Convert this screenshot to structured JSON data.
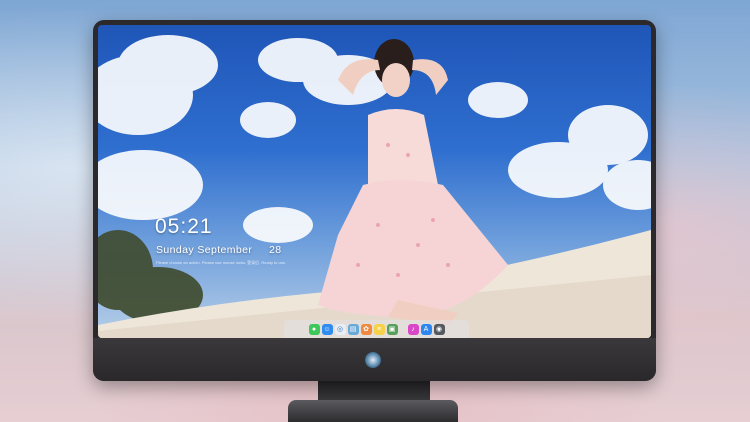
{
  "lockscreen": {
    "time": "05:21",
    "weekday": "Sunday",
    "month": "September",
    "day": "28",
    "notice": "Please choose an action. Please use mouse locks. 登录后. Ready to use."
  },
  "dock": {
    "items": [
      {
        "name": "messages-icon",
        "color": "#3fc85a",
        "glyph": "●"
      },
      {
        "name": "finder-icon",
        "color": "#2f8cf0",
        "glyph": "☺"
      },
      {
        "name": "safari-icon",
        "color": "#e8eef4",
        "glyph": "◎"
      },
      {
        "name": "preview-icon",
        "color": "#6aa8d8",
        "glyph": "▤"
      },
      {
        "name": "photos-icon",
        "color": "#f08a40",
        "glyph": "✿"
      },
      {
        "name": "notes-icon",
        "color": "#f5d24a",
        "glyph": "≡"
      },
      {
        "name": "image-capture-icon",
        "color": "#58a05a",
        "glyph": "▣"
      },
      {
        "name": "itunes-icon",
        "color": "#d946c8",
        "glyph": "♪"
      },
      {
        "name": "app-store-icon",
        "color": "#2e86f0",
        "glyph": "A"
      },
      {
        "name": "camera-icon",
        "color": "#555a60",
        "glyph": "◉"
      }
    ]
  }
}
